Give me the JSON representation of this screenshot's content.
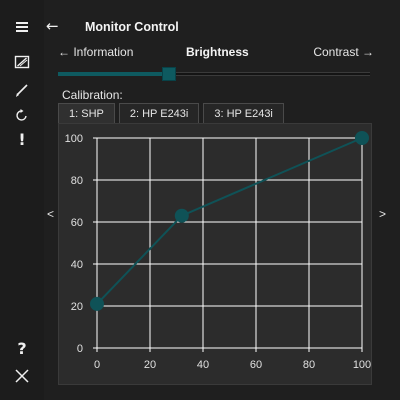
{
  "app": {
    "title": "Monitor Control"
  },
  "sidebar": {
    "items": [
      {
        "icon": "hamburger-menu-icon"
      },
      {
        "icon": "screen-edit-icon"
      },
      {
        "icon": "brush-icon"
      },
      {
        "icon": "refresh-icon"
      },
      {
        "icon": "exclamation-icon",
        "glyph": "!"
      },
      {
        "icon": "help-icon",
        "glyph": "?"
      },
      {
        "icon": "close-icon"
      }
    ]
  },
  "header": {
    "back_glyph": "←"
  },
  "nav": {
    "prev_label": "← Information",
    "current_label": "Brightness",
    "next_label": "Contrast →",
    "left_chevron": "<",
    "right_chevron": ">"
  },
  "slider": {
    "value_fraction": 0.35
  },
  "calibration": {
    "label": "Calibration:",
    "tabs": [
      "1: SHP",
      "2: HP E243i",
      "3: HP E243i"
    ],
    "active_tab": 0
  },
  "colors": {
    "accent": "#0e5a60",
    "line": "#0f5257",
    "chart_bg": "#2c2c2c",
    "grid": "#ffffff"
  },
  "chart_data": {
    "type": "line",
    "x_ticks": [
      "0",
      "20",
      "40",
      "60",
      "80",
      "100"
    ],
    "y_ticks": [
      "0",
      "20",
      "40",
      "60",
      "80",
      "100"
    ],
    "xlim": [
      0,
      100
    ],
    "ylim": [
      0,
      100
    ],
    "grid": true,
    "series": [
      {
        "x": [
          0,
          32,
          100
        ],
        "y": [
          21,
          63,
          100
        ]
      }
    ]
  }
}
